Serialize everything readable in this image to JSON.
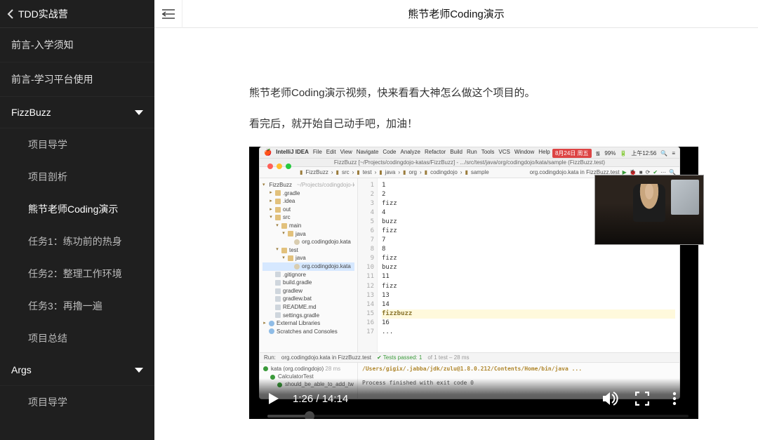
{
  "course_title": "TDD实战营",
  "page_title": "熊节老师Coding演示",
  "collapse_hint": "折叠",
  "intro": [
    "熊节老师Coding演示视频，快来看看大神怎么做这个项目的。",
    "看完后，就开始自己动手吧，加油！"
  ],
  "sidebar": {
    "top_items": [
      {
        "label": "前言-入学须知"
      },
      {
        "label": "前言-学习平台使用"
      }
    ],
    "sections": [
      {
        "label": "FizzBuzz",
        "children": [
          {
            "label": "项目导学"
          },
          {
            "label": "项目剖析"
          },
          {
            "label": "熊节老师Coding演示",
            "active": true
          },
          {
            "label": "任务1：练功前的热身"
          },
          {
            "label": "任务2：整理工作环境"
          },
          {
            "label": "任务3：再擼一遍"
          },
          {
            "label": "项目总结"
          }
        ]
      },
      {
        "label": "Args",
        "children": [
          {
            "label": "项目导学"
          }
        ]
      }
    ]
  },
  "video": {
    "time_current": "1:26",
    "time_total": "14:14",
    "time_label": "1:26 / 14:14",
    "ide": {
      "app": "IntelliJ IDEA",
      "menus": [
        "File",
        "Edit",
        "View",
        "Navigate",
        "Code",
        "Analyze",
        "Refactor",
        "Build",
        "Run",
        "Tools",
        "VCS",
        "Window",
        "Help"
      ],
      "clock": "上午12:56",
      "date_badge": "8月24日 周五",
      "battery": "99%",
      "window_title": "FizzBuzz [~/Projects/codingdojo-katas/FizzBuzz] - .../src/test/java/org/codingdojo/kata/sample (FizzBuzz.test)",
      "breadcrumb": [
        "FizzBuzz",
        "src",
        "test",
        "java",
        "org",
        "codingdojo",
        "sample"
      ],
      "run_config": "org.codingdojo.kata in FizzBuzz.test",
      "tree": [
        {
          "d": 0,
          "t": "FizzBuzz",
          "ic": "mod",
          "caret": "▾",
          "note": "~/Projects/codingdojo-katas/FizzBuzz"
        },
        {
          "d": 1,
          "t": ".gradle",
          "ic": "folder",
          "caret": "▸"
        },
        {
          "d": 1,
          "t": ".idea",
          "ic": "folder",
          "caret": "▸"
        },
        {
          "d": 1,
          "t": "out",
          "ic": "folder",
          "caret": "▸"
        },
        {
          "d": 1,
          "t": "src",
          "ic": "folder",
          "caret": "▾"
        },
        {
          "d": 2,
          "t": "main",
          "ic": "folder",
          "caret": "▾"
        },
        {
          "d": 3,
          "t": "java",
          "ic": "folder",
          "caret": "▾"
        },
        {
          "d": 4,
          "t": "org.codingdojo.kata",
          "ic": "pkg",
          "caret": ""
        },
        {
          "d": 2,
          "t": "test",
          "ic": "folder",
          "caret": "▾"
        },
        {
          "d": 3,
          "t": "java",
          "ic": "folder",
          "caret": "▾"
        },
        {
          "d": 4,
          "t": "org.codingdojo.kata",
          "ic": "pkg",
          "caret": "",
          "sel": true
        },
        {
          "d": 1,
          "t": ".gitignore",
          "ic": "file",
          "caret": ""
        },
        {
          "d": 1,
          "t": "build.gradle",
          "ic": "file",
          "caret": ""
        },
        {
          "d": 1,
          "t": "gradlew",
          "ic": "file",
          "caret": ""
        },
        {
          "d": 1,
          "t": "gradlew.bat",
          "ic": "file",
          "caret": ""
        },
        {
          "d": 1,
          "t": "README.md",
          "ic": "file",
          "caret": ""
        },
        {
          "d": 1,
          "t": "settings.gradle",
          "ic": "file",
          "caret": ""
        },
        {
          "d": 0,
          "t": "External Libraries",
          "ic": "mod",
          "caret": "▸"
        },
        {
          "d": 0,
          "t": "Scratches and Consoles",
          "ic": "mod",
          "caret": ""
        }
      ],
      "editor": {
        "start_line": 1,
        "highlight_line": 15,
        "lines": [
          "1",
          "2",
          "fizz",
          "4",
          "buzz",
          "fizz",
          "7",
          "8",
          "fizz",
          "buzz",
          "11",
          "fizz",
          "13",
          "14",
          "fizzbuzz",
          "16",
          "..."
        ]
      },
      "run": {
        "target": "org.codingdojo.kata in FizzBuzz.test",
        "tests_passed": "Tests passed: 1",
        "tests_detail": "of 1 test – 28 ms",
        "timing": "28 ms",
        "tree": [
          "kata (org.codingdojo)",
          "CalculatorTest",
          "should_be_able_to_add_tw"
        ],
        "out1": "/Users/gigix/.jabba/jdk/zulu@1.8.0.212/Contents/Home/bin/java ...",
        "out2": "Process finished with exit code 0"
      }
    }
  }
}
